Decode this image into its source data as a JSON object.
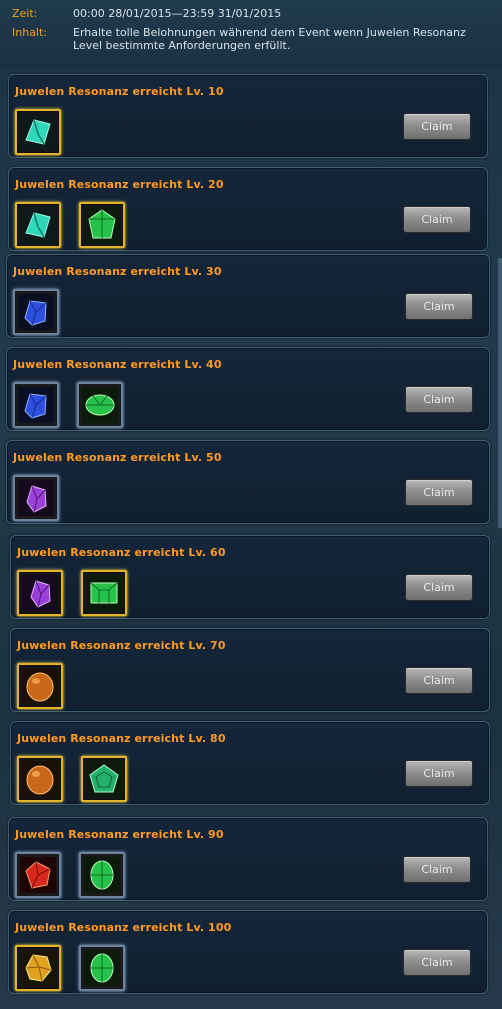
{
  "info": {
    "time_label": "Zeit:",
    "time_value": "00:00 28/01/2015—23:59 31/01/2015",
    "content_label": "Inhalt:",
    "content_value": "Erhalte tolle Belohnungen während dem Event wenn Juwelen Resonanz Level bestimmte Anforderungen erfüllt."
  },
  "colors": {
    "title_orange": "#ff9a23",
    "label_orange": "#f0a21c",
    "slot_gold": "#e4b52a",
    "button_gray": "#8e8e8e"
  },
  "rewards": [
    {
      "title": "Juwelen Resonanz erreicht Lv. 10",
      "button": "Claim",
      "items": [
        "teal-crystal-icon"
      ]
    },
    {
      "title": "Juwelen Resonanz erreicht Lv. 20",
      "button": "Claim",
      "items": [
        "teal-crystal-icon",
        "green-gem-icon"
      ]
    },
    {
      "title": "Juwelen Resonanz erreicht Lv. 30",
      "button": "Claim",
      "items": [
        "blue-crystal-icon"
      ]
    },
    {
      "title": "Juwelen Resonanz erreicht Lv. 40",
      "button": "Claim",
      "items": [
        "blue-crystal-icon",
        "green-gem-icon"
      ]
    },
    {
      "title": "Juwelen Resonanz erreicht Lv. 50",
      "button": "Claim",
      "items": [
        "purple-crystal-icon"
      ]
    },
    {
      "title": "Juwelen Resonanz erreicht Lv. 60",
      "button": "Claim",
      "items": [
        "purple-crystal-icon",
        "green-gem-icon"
      ]
    },
    {
      "title": "Juwelen Resonanz erreicht Lv. 70",
      "button": "Claim",
      "items": [
        "orange-crystal-icon"
      ]
    },
    {
      "title": "Juwelen Resonanz erreicht Lv. 80",
      "button": "Claim",
      "items": [
        "orange-crystal-icon",
        "green-gem-icon"
      ]
    },
    {
      "title": "Juwelen Resonanz erreicht Lv. 90",
      "button": "Claim",
      "items": [
        "red-crystal-icon",
        "green-gem-icon"
      ]
    },
    {
      "title": "Juwelen Resonanz erreicht Lv. 100",
      "button": "Claim",
      "items": [
        "yellow-crystal-icon",
        "green-gem-icon"
      ]
    }
  ]
}
